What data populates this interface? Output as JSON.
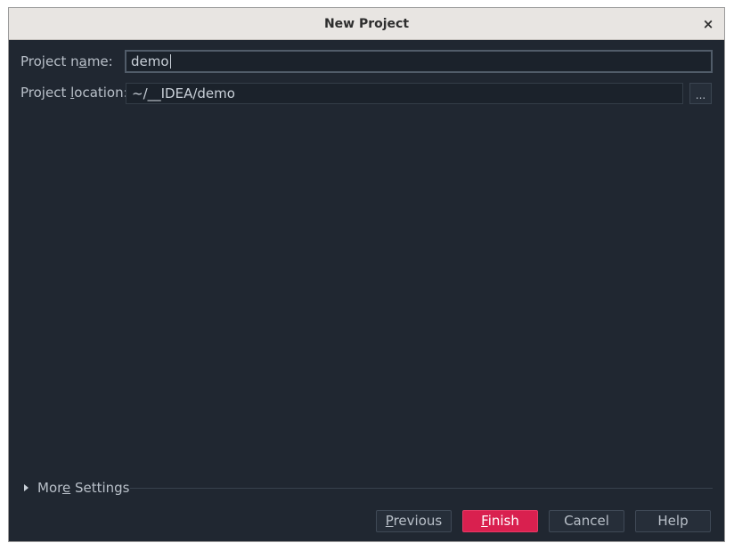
{
  "window": {
    "title": "New Project",
    "close_glyph": "×"
  },
  "form": {
    "name_label_pre": "Project n",
    "name_label_mnemonic": "a",
    "name_label_post": "me:",
    "name_value": "demo",
    "location_label_pre": "Project ",
    "location_label_mnemonic": "l",
    "location_label_post": "ocation:",
    "location_value": "~/__IDEA/demo",
    "browse_label": "..."
  },
  "more_settings": {
    "pre": "Mor",
    "mnemonic": "e",
    "post": " Settings"
  },
  "buttons": {
    "previous_mnemonic": "P",
    "previous_rest": "revious",
    "finish_mnemonic": "F",
    "finish_rest": "inish",
    "cancel": "Cancel",
    "help": "Help"
  },
  "colors": {
    "background": "#202731",
    "accent": "#d9204f",
    "titlebar": "#e8e5e2"
  }
}
